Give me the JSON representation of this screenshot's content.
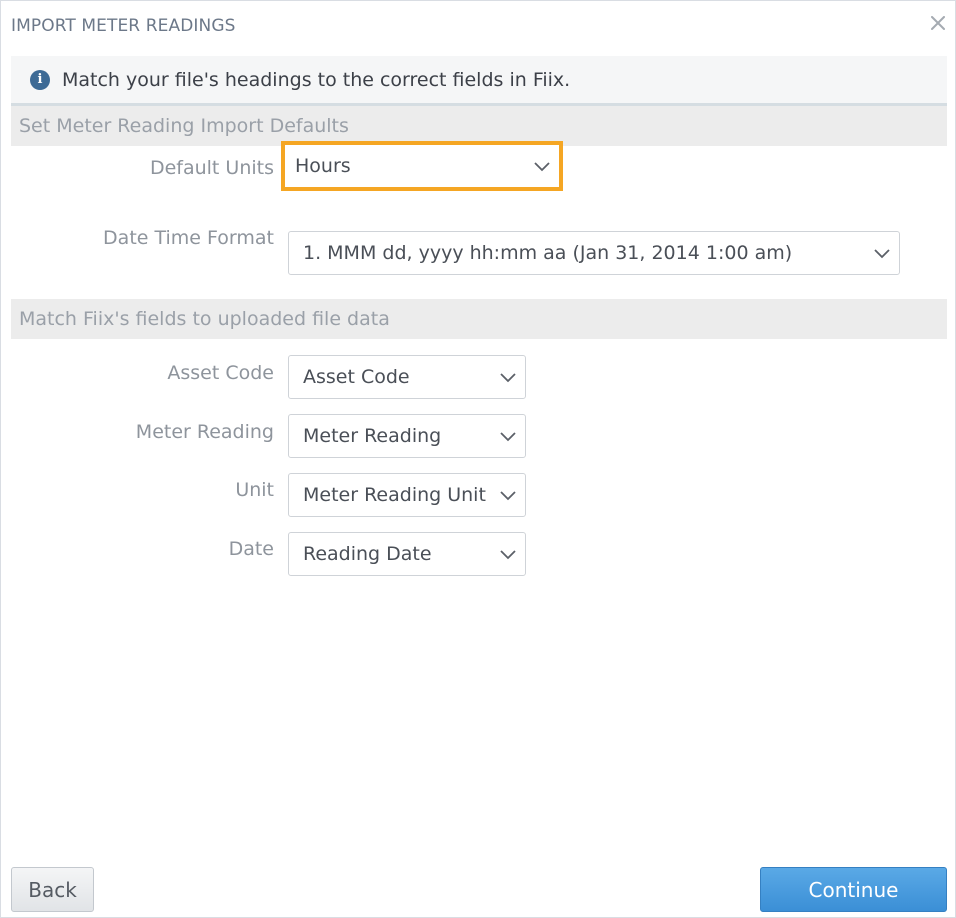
{
  "dialog": {
    "title": "IMPORT METER READINGS",
    "close_icon": "close-icon"
  },
  "info": {
    "icon": "info-icon",
    "text": "Match your file's headings to the correct fields in Fiix."
  },
  "defaults_section": {
    "header": "Set Meter Reading Import Defaults",
    "default_units": {
      "label": "Default Units",
      "value": "Hours"
    },
    "date_time_format": {
      "label": "Date Time Format",
      "value": "1. MMM dd, yyyy hh:mm aa (Jan 31, 2014 1:00 am)"
    }
  },
  "mapping_section": {
    "header": "Match Fiix's fields to uploaded file data",
    "fields": [
      {
        "label": "Asset Code",
        "value": "Asset Code"
      },
      {
        "label": "Meter Reading",
        "value": "Meter Reading"
      },
      {
        "label": "Unit",
        "value": "Meter Reading Unit"
      },
      {
        "label": "Date",
        "value": "Reading Date"
      }
    ]
  },
  "footer": {
    "back_label": "Back",
    "continue_label": "Continue"
  },
  "colors": {
    "highlight": "#f5a623",
    "primary": "#3b8fd6",
    "info_icon": "#3d6a95"
  }
}
